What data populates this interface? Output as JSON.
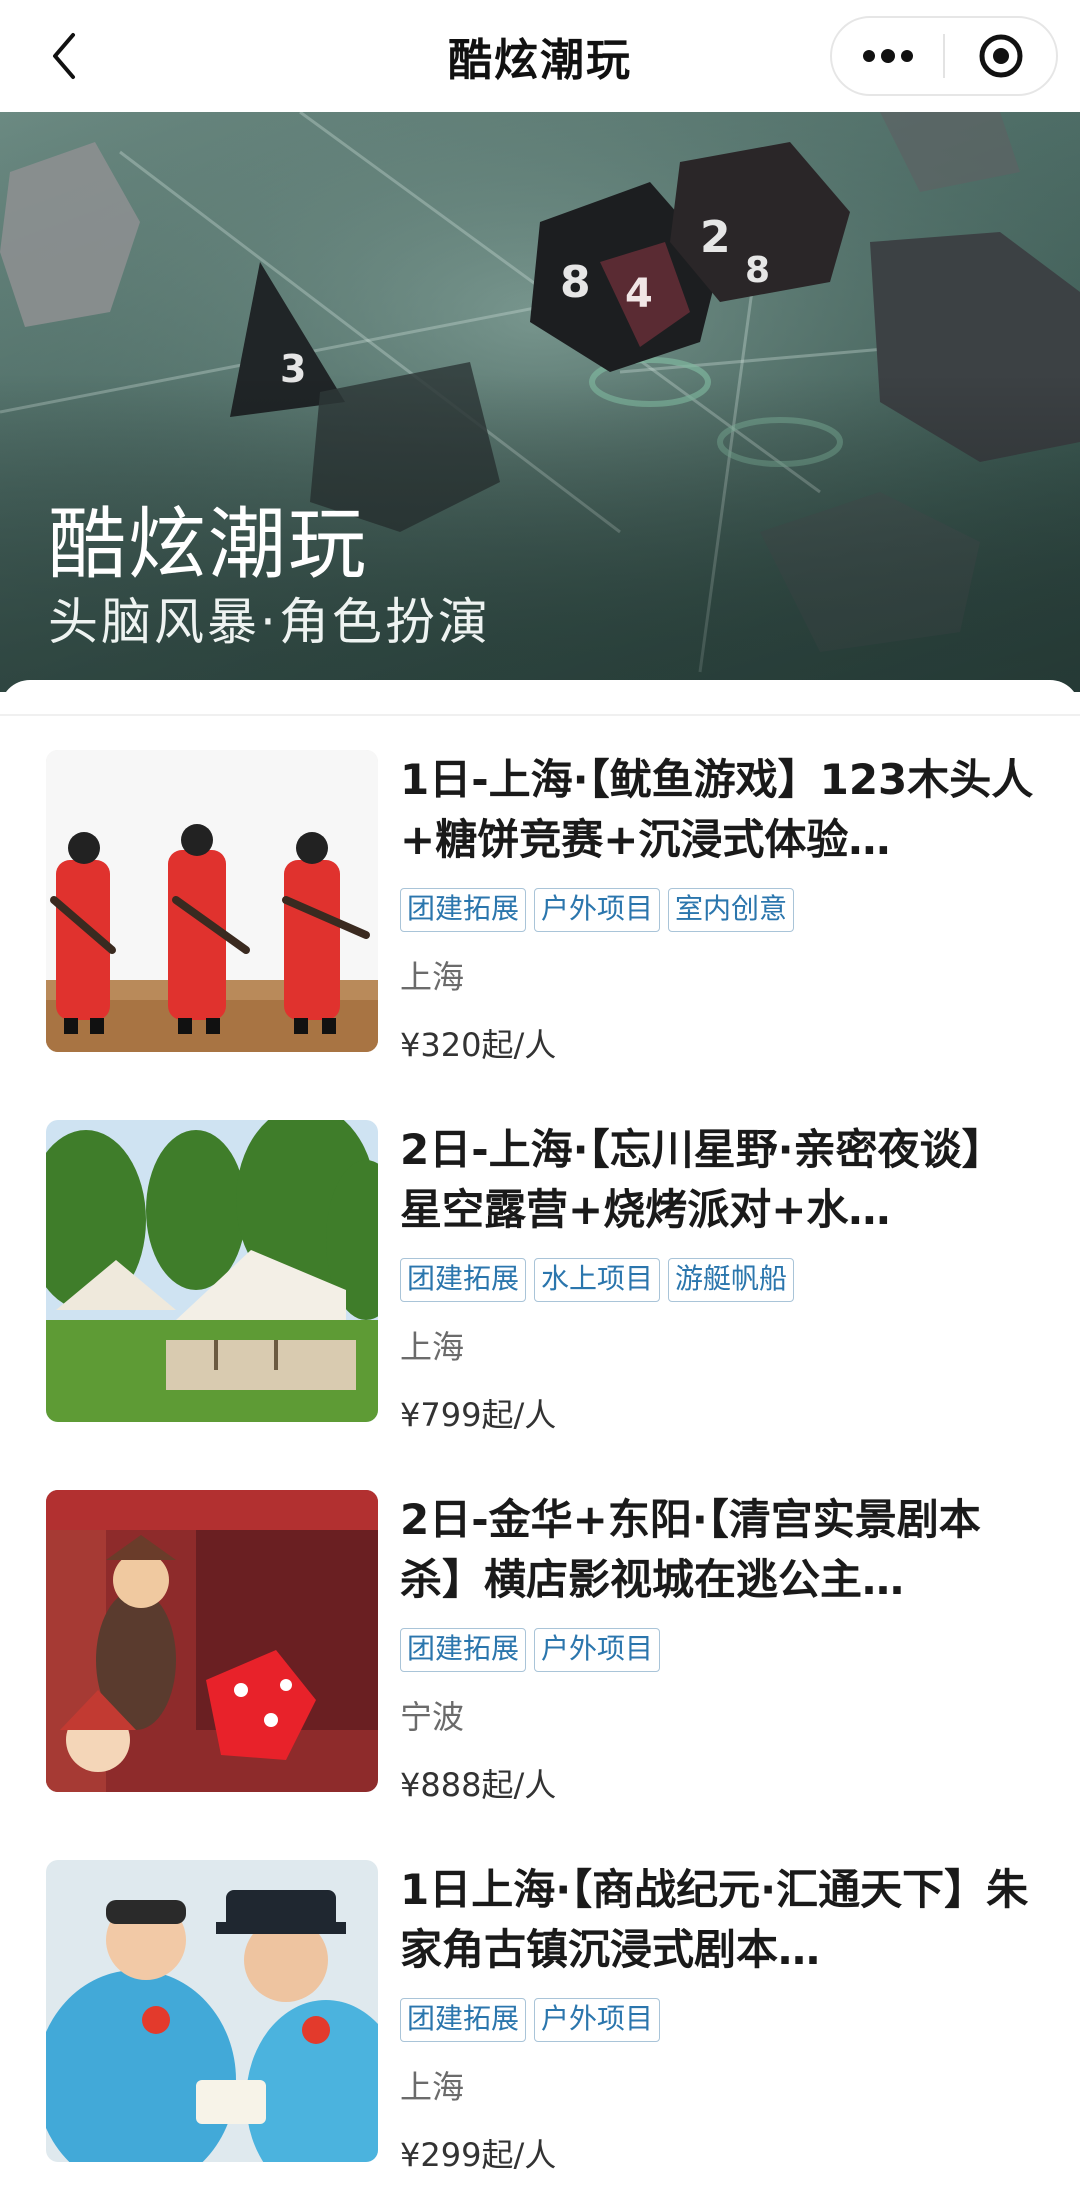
{
  "nav": {
    "title": "酷炫潮玩"
  },
  "hero": {
    "title": "酷炫潮玩",
    "subtitle": "头脑风暴·角色扮演"
  },
  "items": [
    {
      "title": "1日-上海·【鱿鱼游戏】123木头人+糖饼竞赛+沉浸式体验…",
      "tags": [
        "团建拓展",
        "户外项目",
        "室内创意"
      ],
      "location": "上海",
      "price": "¥320起/人"
    },
    {
      "title": "2日-上海·【忘川星野·亲密夜谈】星空露营+烧烤派对+水…",
      "tags": [
        "团建拓展",
        "水上项目",
        "游艇帆船"
      ],
      "location": "上海",
      "price": "¥799起/人"
    },
    {
      "title": "2日-金华+东阳·【清宫实景剧本杀】横店影视城在逃公主…",
      "tags": [
        "团建拓展",
        "户外项目"
      ],
      "location": "宁波",
      "price": "¥888起/人"
    },
    {
      "title": "1日上海·【商战纪元·汇通天下】朱家角古镇沉浸式剧本…",
      "tags": [
        "团建拓展",
        "户外项目"
      ],
      "location": "上海",
      "price": "¥299起/人"
    }
  ],
  "colors": {
    "tag_text": "#2b76ad",
    "tag_border": "#a9c4d8",
    "hero_bg": "#4f6f68"
  }
}
